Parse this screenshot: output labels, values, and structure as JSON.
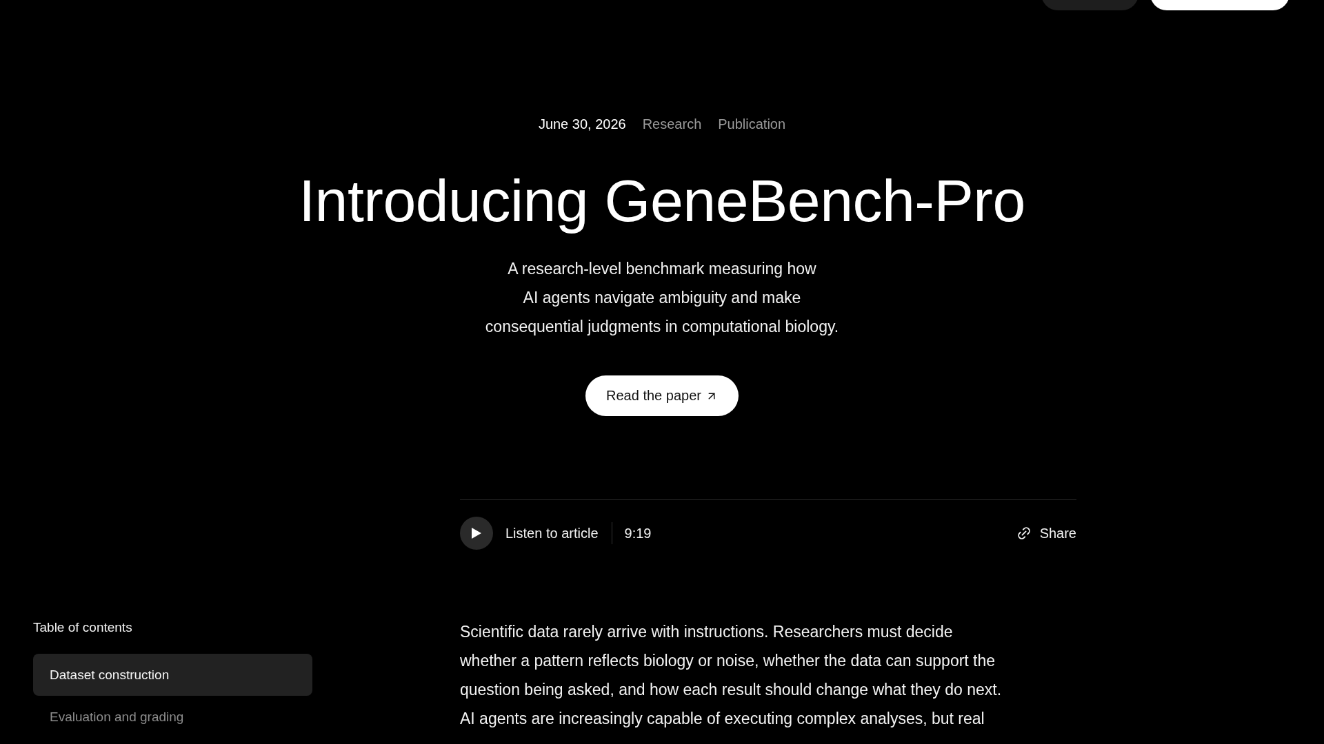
{
  "header": {
    "buttons": [
      {
        "kind": "secondary"
      },
      {
        "kind": "primary"
      }
    ]
  },
  "meta": {
    "date": "June 30, 2026",
    "tags": [
      "Research",
      "Publication"
    ]
  },
  "title": "Introducing GeneBench-Pro",
  "subtitle": {
    "lines": [
      "A research-level benchmark measuring how",
      "AI agents navigate ambiguity and make",
      "consequential judgments in computational biology."
    ]
  },
  "cta": {
    "label": "Read the paper"
  },
  "audio": {
    "label": "Listen to article",
    "duration": "9:19",
    "share": "Share"
  },
  "toc": {
    "title": "Table of contents",
    "items": [
      {
        "label": "Dataset construction",
        "selected": true
      },
      {
        "label": "Evaluation and grading",
        "selected": false
      }
    ]
  },
  "article": {
    "lines": [
      "Scientific data rarely arrive with instructions. Researchers must decide",
      "whether a pattern reflects biology or noise, whether the data can support the",
      "question being asked, and how each result should change what they do next.",
      "AI agents are increasingly capable of executing complex analyses, but real"
    ]
  }
}
